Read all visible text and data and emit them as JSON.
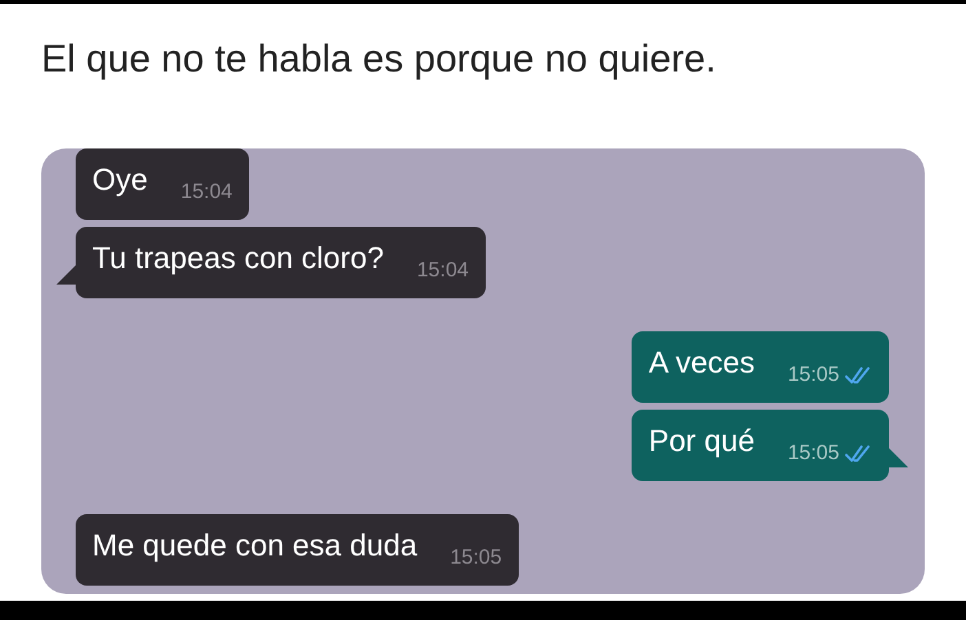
{
  "caption": "El que no te habla es porque no quiere.",
  "messages": [
    {
      "kind": "incoming",
      "text": "Oye",
      "time": "15:04",
      "tail": false
    },
    {
      "kind": "incoming",
      "text": "Tu trapeas con cloro?",
      "time": "15:04",
      "tail": true
    },
    {
      "kind": "outgoing",
      "text": "A veces",
      "time": "15:05",
      "tail": false,
      "read": true
    },
    {
      "kind": "outgoing",
      "text": "Por qué",
      "time": "15:05",
      "tail": true,
      "read": true
    },
    {
      "kind": "incoming",
      "text": "Me quede con esa duda",
      "time": "15:05",
      "tail": false
    }
  ]
}
